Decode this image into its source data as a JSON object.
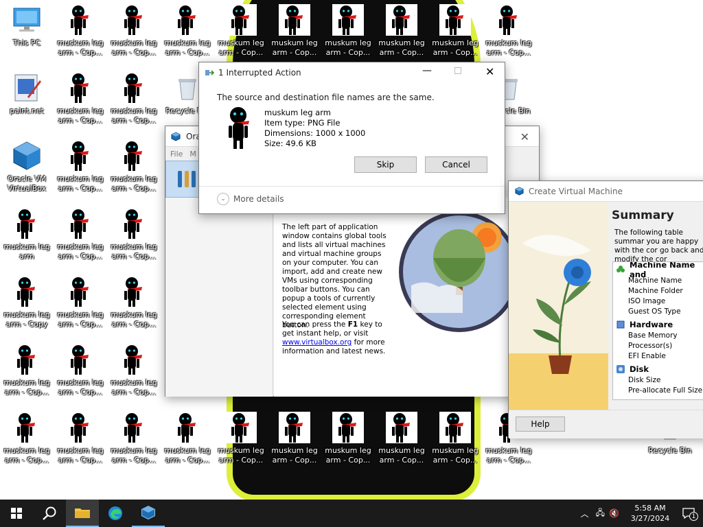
{
  "desktop": {
    "icons": [
      {
        "label": "This PC",
        "kind": "this-pc"
      },
      {
        "label": "paint.net",
        "kind": "paintnet"
      },
      {
        "label": "Oracle VM VirtualBox",
        "kind": "virtualbox"
      },
      {
        "label": "muskum leg arm",
        "kind": "muskum"
      },
      {
        "label": "muskum leg arm - Copy",
        "kind": "muskum"
      },
      {
        "label": "muskum leg arm - Cop...",
        "kind": "muskum"
      },
      {
        "label": "muskum leg arm - Cop...",
        "kind": "muskum"
      },
      {
        "label": "Recycle Bin",
        "kind": "recycle"
      }
    ]
  },
  "interrupted_dialog": {
    "title": "1 Interrupted Action",
    "message": "The source and destination file names are the same.",
    "file_name": "muskum leg arm",
    "item_type": "Item type: PNG File",
    "dimensions": "Dimensions: 1000 x 1000",
    "size": "Size: 49.6 KB",
    "skip_label": "Skip",
    "cancel_label": "Cancel",
    "more_details": "More details"
  },
  "vbox_manager": {
    "title": "Ora",
    "menu": [
      "File",
      "M"
    ],
    "welcome_text": "The left part of application window contains global tools and lists all virtual machines and virtual machine groups on your computer. You can import, add and create new VMs using corresponding toolbar buttons. You can popup a tools of currently selected element using corresponding element button.",
    "help_prefix": "You can press the ",
    "help_key": "F1",
    "help_mid": " key to get instant help, or visit ",
    "help_link": "www.virtualbox.org",
    "help_suffix": " for more information and latest news."
  },
  "create_vm": {
    "title": "Create Virtual Machine",
    "heading": "Summary",
    "intro": "The following table summar you are happy with the cor go back and modify the cor",
    "sections": [
      {
        "name": "Machine Name and",
        "icon": "clover-icon",
        "rows": [
          "Machine Name",
          "Machine Folder",
          "ISO Image",
          "Guest OS Type"
        ]
      },
      {
        "name": "Hardware",
        "icon": "chip-icon",
        "rows": [
          "Base Memory",
          "Processor(s)",
          "EFI Enable"
        ]
      },
      {
        "name": "Disk",
        "icon": "disk-icon",
        "rows": [
          "Disk Size",
          "Pre-allocate Full Size"
        ]
      }
    ],
    "help_label": "Help"
  },
  "taskbar": {
    "time": "5:58 AM",
    "date": "3/27/2024",
    "notification_count": "1"
  }
}
